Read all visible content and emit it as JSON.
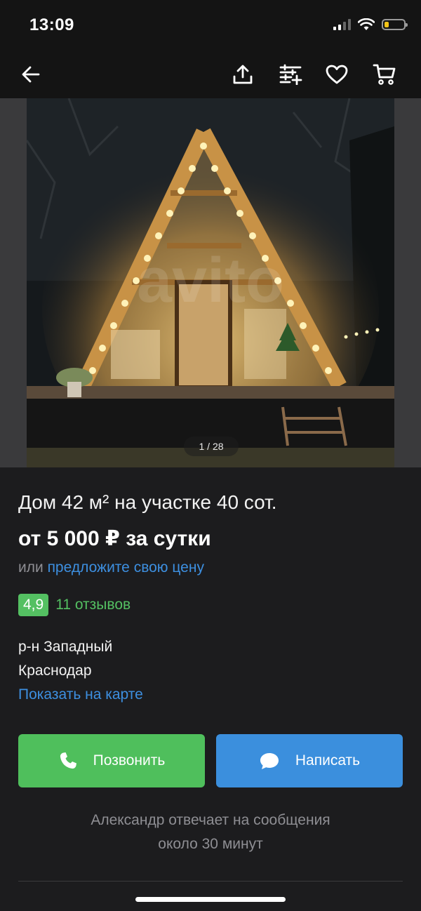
{
  "status_bar": {
    "time": "13:09",
    "battery_level": 0.22
  },
  "nav": {
    "icons": [
      "back-arrow-icon",
      "share-icon",
      "compare-icon",
      "heart-icon",
      "cart-icon"
    ]
  },
  "gallery": {
    "counter": "1 / 28",
    "watermark": "avito"
  },
  "listing": {
    "title": "Дом 42 м² на участке 40 сот.",
    "price": "от 5 000 ₽ за сутки",
    "offer_prefix": "или",
    "offer_link": "предложите свою цену",
    "rating": "4,9",
    "reviews": "11 отзывов",
    "district": "р-н Западный",
    "city": "Краснодар",
    "map_link": "Показать на карте"
  },
  "actions": {
    "call": "Позвонить",
    "write": "Написать"
  },
  "seller_note": {
    "line1": "Александр отвечает на сообщения",
    "line2": "около 30 минут"
  },
  "colors": {
    "background": "#1c1c1e",
    "green": "#4fbf5c",
    "blue": "#3b8fdd",
    "link": "#3d8fe0",
    "muted": "#8e8e93"
  }
}
